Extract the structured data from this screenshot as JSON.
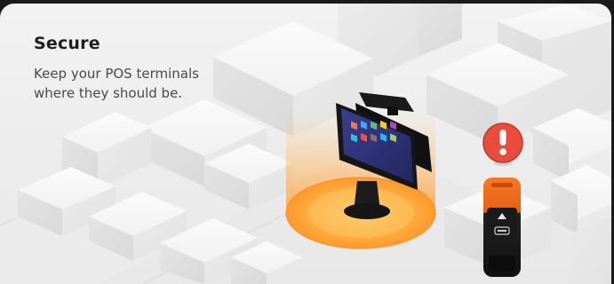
{
  "feature": {
    "title": "Secure",
    "description_lines": [
      "Keep your POS terminals",
      "where they should be."
    ]
  },
  "colors": {
    "frame": "#1a1a1a",
    "background": "#efefef",
    "title_text": "#1f1f1f",
    "body_text": "#4a4a4a",
    "geofence_glow": "#ffb347",
    "alert_red": "#e74c3c",
    "handheld_accent": "#f26a1b",
    "terminal_body": "#1c1c1c"
  },
  "illustration": {
    "scene": "isometric-city-blocks",
    "icons": [
      "pos-terminal-icon",
      "handheld-pos-icon",
      "alert-exclamation-icon"
    ]
  }
}
